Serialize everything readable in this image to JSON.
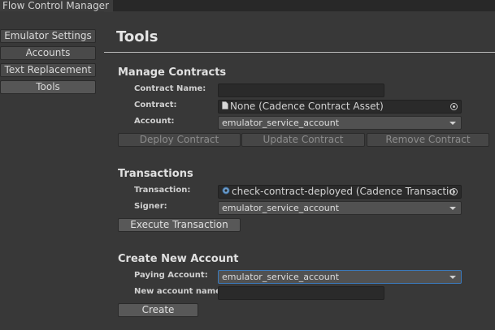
{
  "window": {
    "tab_title": "Flow Control Manager"
  },
  "sidebar": {
    "items": [
      {
        "label": "Emulator Settings"
      },
      {
        "label": "Accounts"
      },
      {
        "label": "Text Replacement"
      },
      {
        "label": "Tools"
      }
    ],
    "selected": "Tools"
  },
  "page": {
    "title": "Tools"
  },
  "manage_contracts": {
    "heading": "Manage Contracts",
    "contract_name_label": "Contract Name:",
    "contract_name_value": "",
    "contract_label": "Contract:",
    "contract_value": "None (Cadence Contract Asset)",
    "account_label": "Account:",
    "account_value": "emulator_service_account",
    "deploy_button": "Deploy Contract",
    "update_button": "Update Contract",
    "remove_button": "Remove Contract"
  },
  "transactions": {
    "heading": "Transactions",
    "transaction_label": "Transaction:",
    "transaction_value": "check-contract-deployed (Cadence Transactio",
    "signer_label": "Signer:",
    "signer_value": "emulator_service_account",
    "execute_button": "Execute Transaction"
  },
  "create_account": {
    "heading": "Create New Account",
    "paying_account_label": "Paying Account:",
    "paying_account_value": "emulator_service_account",
    "new_account_name_label": "New account name:",
    "new_account_name_value": "",
    "create_button": "Create"
  },
  "icons": {
    "contract_field_icon": "document-icon",
    "transaction_field_icon": "cadence-asset-icon",
    "picker_icon": "object-picker-icon",
    "dropdown_icon": "chevron-down-icon"
  }
}
